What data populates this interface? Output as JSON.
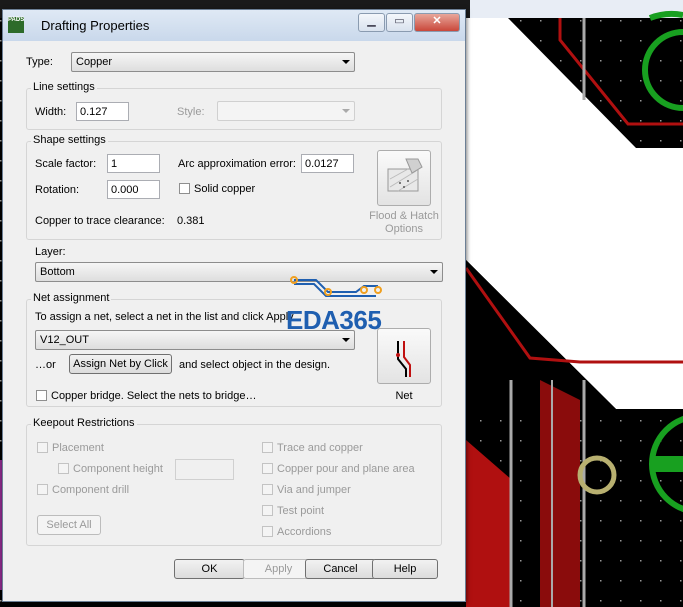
{
  "dialog": {
    "title": "Drafting Properties",
    "app_icon_text": "PADS",
    "type_label": "Type:",
    "type_value": "Copper",
    "line_settings": {
      "title": "Line settings",
      "width_label": "Width:",
      "width_value": "0.127",
      "style_label": "Style:",
      "style_value": ""
    },
    "shape_settings": {
      "title": "Shape settings",
      "scale_label": "Scale factor:",
      "scale_value": "1",
      "arc_label": "Arc approximation error:",
      "arc_value": "0.0127",
      "rotation_label": "Rotation:",
      "rotation_value": "0.000",
      "solid_copper_label": "Solid copper",
      "solid_copper_checked": false,
      "clearance_label": "Copper to trace clearance:",
      "clearance_value": "0.381",
      "flood_label_1": "Flood & Hatch",
      "flood_label_2": "Options"
    },
    "layer": {
      "title": "Layer:",
      "value": "Bottom"
    },
    "net_assignment": {
      "title": "Net assignment",
      "instruction": "To assign a net, select a net in the list and click Apply.",
      "net_value": "V12_OUT",
      "or_label": "…or",
      "assign_button": "Assign Net by Click",
      "after_assign": "and select object in the design.",
      "copper_bridge_label": "Copper bridge. Select the nets to bridge…",
      "copper_bridge_checked": false,
      "net_button_label": "Net"
    },
    "keepout": {
      "title": "Keepout Restrictions",
      "placement": "Placement",
      "component_height": "Component height",
      "component_height_value": "",
      "component_drill": "Component drill",
      "select_all": "Select All",
      "trace_and_copper": "Trace and copper",
      "copper_pour": "Copper pour and plane area",
      "via_and_jumper": "Via and jumper",
      "test_point": "Test point",
      "accordions": "Accordions"
    },
    "buttons": {
      "ok": "OK",
      "apply": "Apply",
      "cancel": "Cancel",
      "help": "Help"
    }
  },
  "watermark": "EDA365",
  "colors": {
    "pcb_background": "#000000",
    "copper_red": "#b01010",
    "via_green": "#18a020",
    "white_area": "#ffffff",
    "watermark_blue": "#1f5fb0",
    "watermark_orange": "#f0a020"
  }
}
